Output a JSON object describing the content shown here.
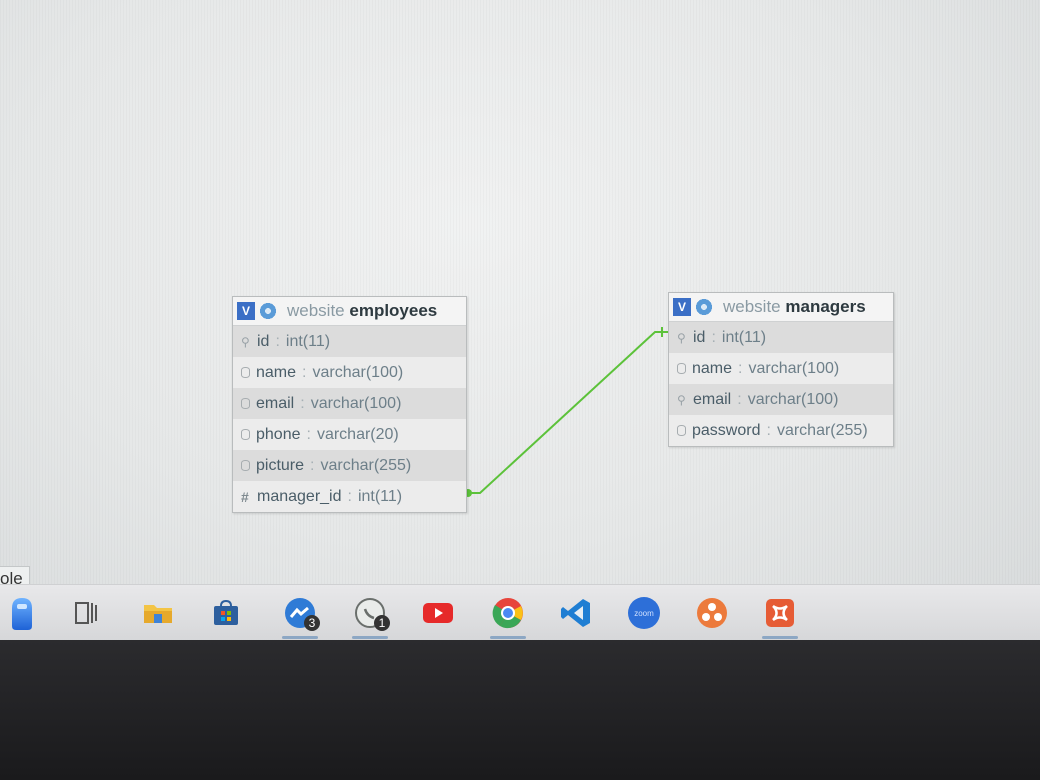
{
  "tables": {
    "employees": {
      "schema": "website",
      "name": "employees",
      "columns": [
        {
          "name": "id",
          "type": "int(11)",
          "icon": "key-icon"
        },
        {
          "name": "name",
          "type": "varchar(100)",
          "icon": "column-icon"
        },
        {
          "name": "email",
          "type": "varchar(100)",
          "icon": "column-icon"
        },
        {
          "name": "phone",
          "type": "varchar(20)",
          "icon": "column-icon"
        },
        {
          "name": "picture",
          "type": "varchar(255)",
          "icon": "column-icon"
        },
        {
          "name": "manager_id",
          "type": "int(11)",
          "icon": "hash-icon"
        }
      ]
    },
    "managers": {
      "schema": "website",
      "name": "managers",
      "columns": [
        {
          "name": "id",
          "type": "int(11)",
          "icon": "key-icon"
        },
        {
          "name": "name",
          "type": "varchar(100)",
          "icon": "column-icon"
        },
        {
          "name": "email",
          "type": "varchar(100)",
          "icon": "key-icon"
        },
        {
          "name": "password",
          "type": "varchar(255)",
          "icon": "column-icon"
        }
      ]
    }
  },
  "header_badge": "V",
  "side_label": "ole",
  "taskbar": {
    "items": [
      {
        "icon": "assistant-icon"
      },
      {
        "icon": "task-view-icon"
      },
      {
        "icon": "file-explorer-icon"
      },
      {
        "icon": "store-icon"
      },
      {
        "icon": "messenger-icon",
        "badge": "3"
      },
      {
        "icon": "whatsapp-icon",
        "badge": "1"
      },
      {
        "icon": "youtube-icon"
      },
      {
        "icon": "chrome-icon"
      },
      {
        "icon": "vscode-icon"
      },
      {
        "icon": "zoom-icon",
        "label": "zoom"
      },
      {
        "icon": "orange-app-icon"
      },
      {
        "icon": "xampp-icon"
      }
    ]
  },
  "colors": {
    "relation_line": "#5cc23a",
    "header_badge": "#3b6fc6"
  }
}
